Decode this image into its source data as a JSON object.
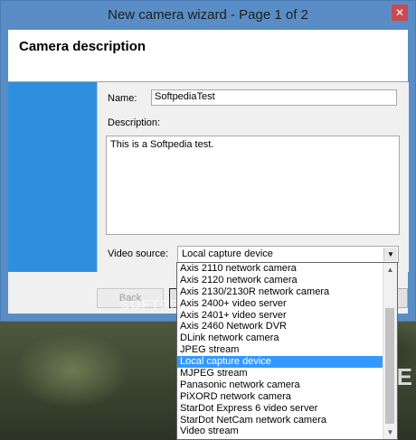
{
  "window": {
    "title": "New camera wizard - Page 1 of 2",
    "close_glyph": "✕"
  },
  "header": {
    "title": "Camera description"
  },
  "form": {
    "name_label": "Name:",
    "name_value": "SoftpediaTest",
    "description_label": "Description:",
    "description_value": "This is a Softpedia test.",
    "video_source_label": "Video source:",
    "video_source_value": "Local capture device"
  },
  "buttons": {
    "back": "Back",
    "next": "",
    "right": ""
  },
  "watermark": "SOFTPEDIA",
  "background": {
    "right_text": "PE"
  },
  "dropdown": {
    "options": [
      "Axis 2110 network camera",
      "Axis 2120 network camera",
      "Axis 2130/2130R network camera",
      "Axis 2400+ video server",
      "Axis 2401+ video server",
      "Axis 2460 Network DVR",
      "DLink network camera",
      "JPEG stream",
      "Local capture device",
      "MJPEG stream",
      "Panasonic network camera",
      "PiXORD network camera",
      "StarDot Express 6 video server",
      "StarDot NetCam network camera",
      "Video stream"
    ],
    "selected_index": 8
  },
  "colors": {
    "title_bar": "#5a8dc6",
    "close_button": "#c74b50",
    "left_band": "#2f8fdf",
    "selection": "#3399ff"
  },
  "icons": {
    "close": "close-icon",
    "dropdown_arrow": "chevron-down-icon",
    "scroll_up": "scroll-up-arrow-icon",
    "scroll_down": "scroll-down-arrow-icon"
  }
}
